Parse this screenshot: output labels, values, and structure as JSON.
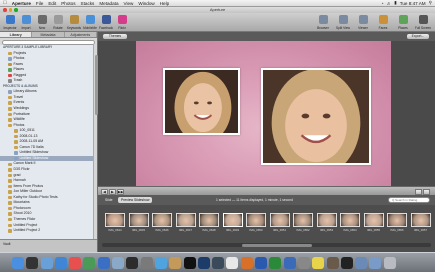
{
  "menubar": {
    "apple": "",
    "app": "Aperture",
    "items": [
      "File",
      "Edit",
      "Photos",
      "Stacks",
      "Metadata",
      "View",
      "Window",
      "Help"
    ],
    "clock": "Tue 8:47 AM"
  },
  "window": {
    "title": "Aperture"
  },
  "toolbar": {
    "left": [
      {
        "label": "Inspector",
        "icon": "info-icon",
        "color": "#3a78c9"
      },
      {
        "label": "Import",
        "icon": "import-icon",
        "color": "#4c8fd6"
      },
      {
        "label": "New",
        "icon": "new-icon",
        "color": "#6a6a6a"
      },
      {
        "label": "Rotate",
        "icon": "rotate-icon",
        "color": "#9a9a9a"
      },
      {
        "label": "Keywords",
        "icon": "keywords-icon",
        "color": "#b58b3d"
      },
      {
        "label": "MobileMe",
        "icon": "mobileme-icon",
        "color": "#4a90d9"
      },
      {
        "label": "Facebook",
        "icon": "facebook-icon",
        "color": "#3b5998"
      },
      {
        "label": "Flickr",
        "icon": "flickr-icon",
        "color": "#d43d8a"
      }
    ],
    "right": [
      {
        "label": "Browser",
        "icon": "browser-icon",
        "color": "#7a8aa0"
      },
      {
        "label": "Split View",
        "icon": "split-view-icon",
        "color": "#7a8aa0"
      },
      {
        "label": "Viewer",
        "icon": "viewer-icon",
        "color": "#7a8aa0"
      },
      {
        "label": "Faces",
        "icon": "faces-icon",
        "color": "#c9923a"
      },
      {
        "label": "Places",
        "icon": "places-icon",
        "color": "#5fa35a"
      },
      {
        "label": "Full Screen",
        "icon": "full-screen-icon",
        "color": "#555"
      }
    ]
  },
  "left_tabs": [
    "Library",
    "Metadata",
    "Adjustments"
  ],
  "library_search_placeholder": "",
  "library": [
    {
      "label": "APERTURE 3 SAMPLE LIBRARY",
      "type": "section"
    },
    {
      "label": "Projects",
      "color": "#c9a24a"
    },
    {
      "label": "Photos",
      "color": "#8aa2c0"
    },
    {
      "label": "Faces",
      "color": "#c9923a"
    },
    {
      "label": "Places",
      "color": "#5fa35a"
    },
    {
      "label": "Flagged",
      "color": "#d44"
    },
    {
      "label": "Trash",
      "color": "#888"
    },
    {
      "label": "PROJECTS & ALBUMS",
      "type": "section"
    },
    {
      "label": "Library Albums",
      "color": "#8aa2c0"
    },
    {
      "label": "Travel",
      "color": "#c9a24a"
    },
    {
      "label": "Events",
      "color": "#c9a24a"
    },
    {
      "label": "Weddings",
      "color": "#c9a24a"
    },
    {
      "label": "Portraiture",
      "color": "#c9a24a"
    },
    {
      "label": "Wildlife",
      "color": "#c9a24a"
    },
    {
      "label": "Photos",
      "color": "#c9a24a"
    },
    {
      "label": "100_0511",
      "color": "#c9a24a"
    },
    {
      "label": "2008-01-13",
      "color": "#c9a24a"
    },
    {
      "label": "2008-11-05 AM",
      "color": "#c9a24a"
    },
    {
      "label": "Canon 7D Italia",
      "color": "#c9a24a"
    },
    {
      "label": "Untitled Slideshow",
      "color": "#8aa2c0"
    },
    {
      "label": "Untitled Slideshow",
      "color": "#8aa2c0",
      "selected": true
    },
    {
      "label": "Canon Mark II",
      "color": "#c9a24a"
    },
    {
      "label": "D3S Flickr",
      "color": "#c9a24a"
    },
    {
      "label": "grad",
      "color": "#c9a24a"
    },
    {
      "label": "Hannah",
      "color": "#c9a24a"
    },
    {
      "label": "Items From Photos",
      "color": "#c9a24a"
    },
    {
      "label": "Jon Miller Outdoor",
      "color": "#c9a24a"
    },
    {
      "label": "Kathy for Studio Photo Tests",
      "color": "#c9a24a"
    },
    {
      "label": "Mountains",
      "color": "#c9a24a"
    },
    {
      "label": "Photoroom",
      "color": "#c9a24a"
    },
    {
      "label": "Shoot 2010",
      "color": "#c9a24a"
    },
    {
      "label": "Themes Flickr",
      "color": "#c9a24a"
    },
    {
      "label": "Untitled Project",
      "color": "#c9a24a"
    },
    {
      "label": "Untitled Project 2",
      "color": "#c9a24a"
    }
  ],
  "left_bottom": "Vault",
  "viewer": {
    "themes_label": "Themes",
    "export_label": "Export..."
  },
  "controls": {
    "buttons": [
      "◀",
      "▶",
      "▶▶"
    ],
    "label": ""
  },
  "strip": {
    "tabs": [
      "Slide",
      "Preview Slideshow"
    ],
    "active_tab": 1,
    "info": "1 selected — 11 items displayed, 1 minute, 1 second",
    "search_placeholder": "Q Search in Rating"
  },
  "filmstrip": [
    {
      "caption": "IMG_0644",
      "color": "#b89a88"
    },
    {
      "caption": "IMG_0645",
      "color": "#9c8c80"
    },
    {
      "caption": "IMG_0646",
      "color": "#a89480"
    },
    {
      "caption": "IMG_0647",
      "color": "#b4a090"
    },
    {
      "caption": "IMG_0648",
      "color": "#9a8878"
    },
    {
      "caption": "IMG_0649",
      "color": "#c0a898"
    },
    {
      "caption": "IMG_0650",
      "color": "#a48c7c"
    },
    {
      "caption": "IMG_0651",
      "color": "#b09888"
    },
    {
      "caption": "IMG_0652",
      "color": "#9e8a7c"
    },
    {
      "caption": "IMG_0653",
      "color": "#b8a090"
    },
    {
      "caption": "IMG_0654",
      "color": "#a89080"
    },
    {
      "caption": "IMG_0655",
      "color": "#bca494"
    },
    {
      "caption": "IMG_0656",
      "color": "#a08878"
    },
    {
      "caption": "IMG_0657",
      "color": "#ac9484"
    }
  ],
  "dock": [
    {
      "name": "finder-icon",
      "color": "#4a8fe0"
    },
    {
      "name": "dashboard-icon",
      "color": "#333"
    },
    {
      "name": "mail-icon",
      "color": "#6aa0d8"
    },
    {
      "name": "safari-icon",
      "color": "#3f86d6"
    },
    {
      "name": "ical-icon",
      "color": "#e85050"
    },
    {
      "name": "iphoto-icon",
      "color": "#4a9a58"
    },
    {
      "name": "itunes-icon",
      "color": "#3b6fc4"
    },
    {
      "name": "preview-icon",
      "color": "#8aa9c8"
    },
    {
      "name": "aperture-icon",
      "color": "#2c2c2c"
    },
    {
      "name": "system-preferences-icon",
      "color": "#7a7a7a"
    },
    {
      "name": "ichat-icon",
      "color": "#4fa4e0"
    },
    {
      "name": "address-book-icon",
      "color": "#c49a5a"
    },
    {
      "name": "terminal-icon",
      "color": "#111"
    },
    {
      "name": "photoshop-icon",
      "color": "#1c3c6a"
    },
    {
      "name": "lightroom-icon",
      "color": "#3a4a5a"
    },
    {
      "name": "textedit-icon",
      "color": "#e8e8e8"
    },
    {
      "name": "firefox-icon",
      "color": "#d8702a"
    },
    {
      "name": "word-icon",
      "color": "#2a5ab0"
    },
    {
      "name": "excel-icon",
      "color": "#2a8a3a"
    },
    {
      "name": "quicktime-icon",
      "color": "#3a6ab8"
    },
    {
      "name": "calculator-icon",
      "color": "#888"
    },
    {
      "name": "stickies-icon",
      "color": "#e8d44a"
    },
    {
      "name": "chess-icon",
      "color": "#6a5a4a"
    },
    {
      "name": "dvd-player-icon",
      "color": "#222"
    },
    {
      "name": "downloads-icon",
      "color": "#6a8ab8"
    },
    {
      "name": "documents-icon",
      "color": "#7a9ac8"
    },
    {
      "name": "trash-icon",
      "color": "#b8bcc2"
    }
  ]
}
